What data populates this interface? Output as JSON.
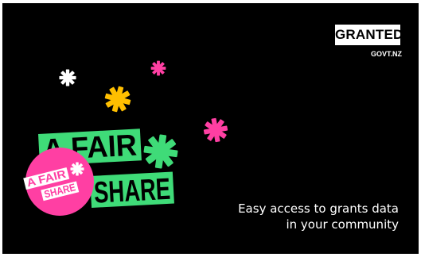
{
  "brand": {
    "logo_main": "GRANTED",
    "logo_sub": "GOVT.NZ"
  },
  "campaign": {
    "headline_line1": "A FAIR",
    "headline_line2": "SHARE",
    "badge_line1": "A FAIR",
    "badge_line2": "SHARE"
  },
  "tagline": {
    "line1": "Easy access to grants data",
    "line2": "in your community"
  },
  "colors": {
    "background": "#000000",
    "green": "#3fdb78",
    "yellow": "#ffbf00",
    "pink": "#ff3fa3",
    "white": "#ffffff"
  },
  "icons": [
    "asterisk-icon",
    "logo-mark"
  ]
}
